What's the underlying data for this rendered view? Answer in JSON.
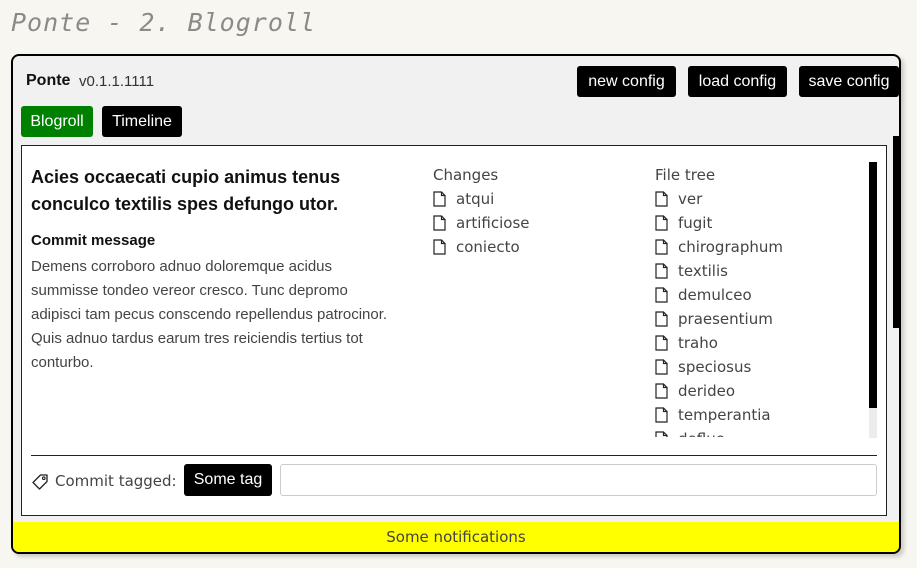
{
  "page": {
    "heading": "Ponte - 2. Blogroll"
  },
  "app": {
    "name": "Ponte",
    "version": "v0.1.1.1111",
    "buttons": {
      "new_config": "new config",
      "load_config": "load config",
      "save_config": "save config"
    },
    "tabs": [
      {
        "label": "Blogroll",
        "active": true,
        "color": "#008000"
      },
      {
        "label": "Timeline",
        "active": false,
        "color": "#000000"
      }
    ]
  },
  "commit": {
    "title": "Acies occaecati cupio animus tenus conculco textilis spes defungo utor.",
    "message_label": "Commit message",
    "message": "Demens corroboro adnuo doloremque acidus summisse tondeo vereor cresco. Tunc depromo adipisci tam pecus conscendo repellendus patrocinor. Quis adnuo tardus earum tres reiciendis tertius tot conturbo."
  },
  "changes": {
    "header": "Changes",
    "files": [
      "atqui",
      "artificiose",
      "coniecto"
    ]
  },
  "file_tree": {
    "header": "File tree",
    "files": [
      "ver",
      "fugit",
      "chirographum",
      "textilis",
      "demulceo",
      "praesentium",
      "traho",
      "speciosus",
      "derideo",
      "temperantia",
      "deflue"
    ]
  },
  "tagging": {
    "label": "Commit tagged:",
    "tag": "Some tag",
    "input_value": "",
    "input_placeholder": ""
  },
  "notifications": {
    "text": "Some notifications",
    "color": "#ffff00"
  }
}
